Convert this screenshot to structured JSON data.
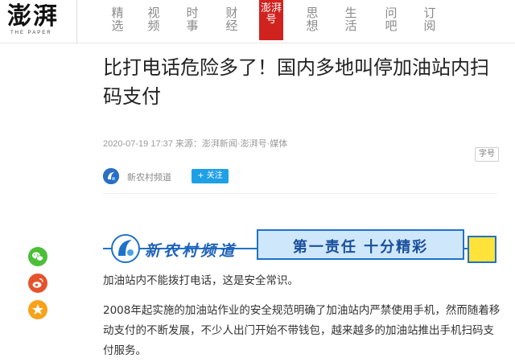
{
  "header": {
    "logo": "澎湃",
    "logo_sub": "THE PAPER",
    "nav": [
      {
        "line1": "精",
        "line2": "选"
      },
      {
        "line1": "视",
        "line2": "频"
      },
      {
        "line1": "时",
        "line2": "事"
      },
      {
        "line1": "财",
        "line2": "经"
      },
      {
        "line1": "澎湃",
        "line2": "号",
        "active": true
      },
      {
        "line1": "思",
        "line2": "想"
      },
      {
        "line1": "生",
        "line2": "活"
      },
      {
        "line1": "问",
        "line2": "吧"
      },
      {
        "line1": "订",
        "line2": "阅"
      }
    ]
  },
  "article": {
    "title": "比打电话危险多了！国内多地叫停加油站内扫码支付",
    "meta": "2020-07-19 17:37 来源：澎湃新闻·澎湃号·媒体",
    "font_size_button": "字号",
    "author": "新农村频道",
    "follow_label": "+ 关注",
    "banner": {
      "name": "新农村频道",
      "slogan": "第一责任  十分精彩"
    },
    "paragraphs": [
      "加油站内不能拨打电话，这是安全常识。",
      "2008年起实施的加油站作业的安全规范明确了加油站内严禁使用手机，然而随着移动支付的不断发展，不少人出门开始不带钱包，越来越多的加油站推出手机扫码支付服务。"
    ]
  },
  "share": {
    "icons": [
      "wechat-icon",
      "weibo-icon",
      "qzone-icon"
    ],
    "colors": {
      "wechat": "#4cbf38",
      "weibo": "#e5532d",
      "qzone": "#f7a21b"
    }
  },
  "colors": {
    "accent": "#d0231f",
    "follow": "#1ea0e6",
    "banner_blue": "#1f72c8"
  }
}
